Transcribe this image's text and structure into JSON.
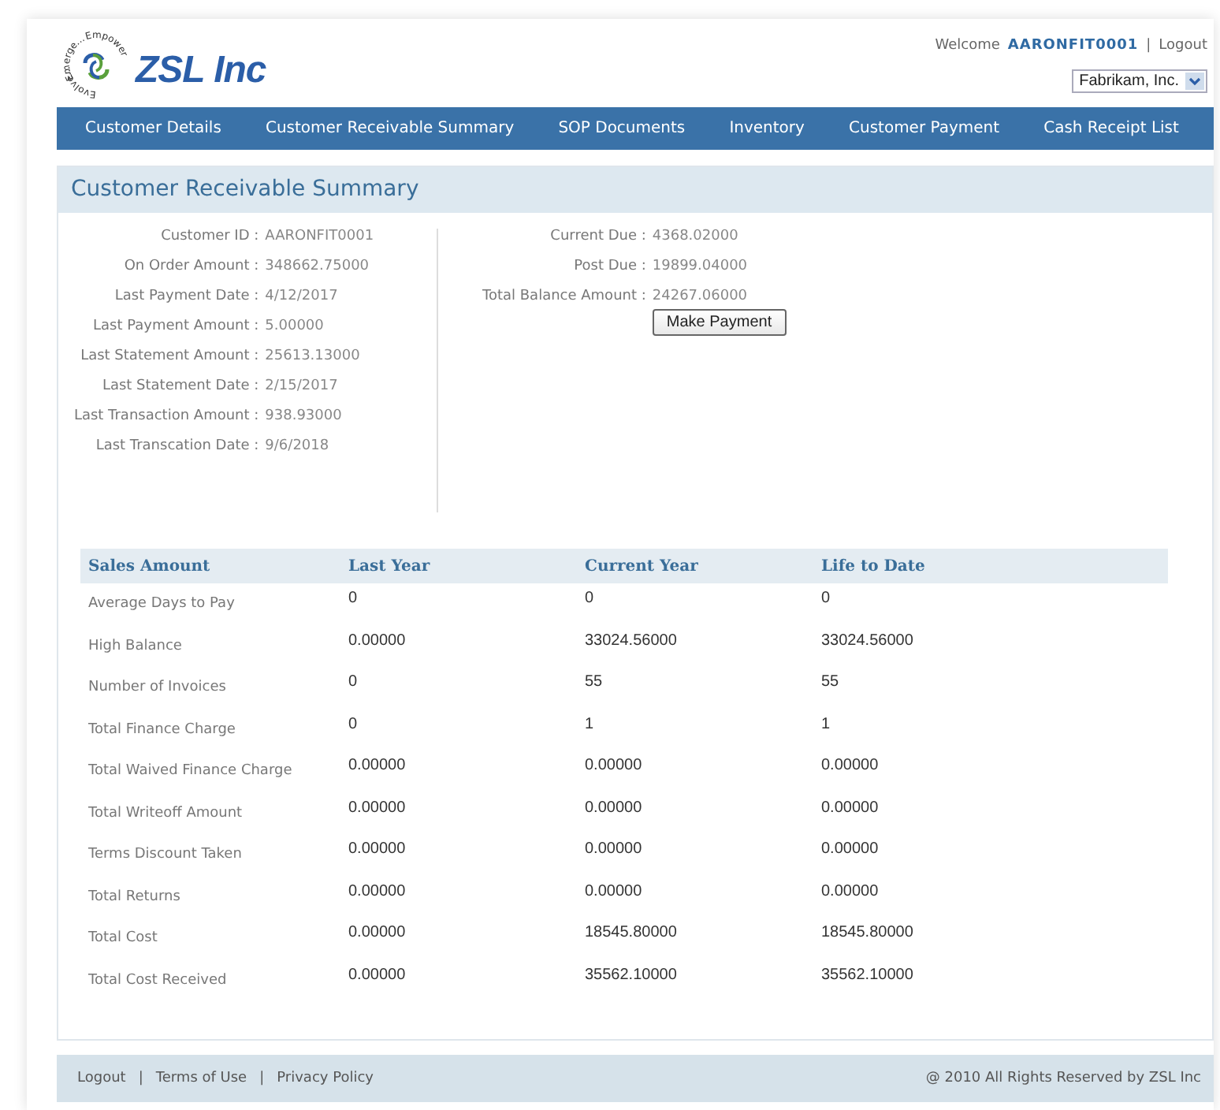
{
  "header": {
    "logo": {
      "name": "ZSL Inc",
      "ring_texts": [
        "Emerge...",
        "Empower",
        "Evolve..."
      ]
    },
    "welcome": "Welcome",
    "user": "AARONFIT0001",
    "separator": "|",
    "logout": "Logout",
    "company_select": {
      "value": "Fabrikam, Inc."
    }
  },
  "nav": [
    "Customer Details",
    "Customer Receivable Summary",
    "SOP Documents",
    "Inventory",
    "Customer Payment",
    "Cash Receipt List"
  ],
  "panel": {
    "title": "Customer Receivable Summary",
    "left_fields": [
      {
        "label": "Customer ID :",
        "value": "AARONFIT0001"
      },
      {
        "label": "On Order Amount :",
        "value": "348662.75000"
      },
      {
        "label": "Last Payment Date :",
        "value": "4/12/2017"
      },
      {
        "label": "Last Payment Amount :",
        "value": "5.00000"
      },
      {
        "label": "Last Statement Amount :",
        "value": "25613.13000"
      },
      {
        "label": "Last Statement Date :",
        "value": "2/15/2017"
      },
      {
        "label": "Last Transaction Amount :",
        "value": "938.93000"
      },
      {
        "label": "Last Transcation Date :",
        "value": "9/6/2018"
      }
    ],
    "right_fields": [
      {
        "label": "Current Due :",
        "value": "4368.02000"
      },
      {
        "label": "Post Due :",
        "value": "19899.04000"
      },
      {
        "label": "Total Balance Amount :",
        "value": "24267.06000"
      }
    ],
    "make_payment": "Make Payment",
    "table": {
      "columns": [
        "Sales Amount",
        "Last Year",
        "Current Year",
        "Life to Date"
      ],
      "rows": [
        [
          "Average Days to Pay",
          "0",
          "0",
          "0"
        ],
        [
          "High Balance",
          "0.00000",
          "33024.56000",
          "33024.56000"
        ],
        [
          "Number of Invoices",
          "0",
          "55",
          "55"
        ],
        [
          "Total Finance Charge",
          "0",
          "1",
          "1"
        ],
        [
          "Total Waived Finance Charge",
          "0.00000",
          "0.00000",
          "0.00000"
        ],
        [
          "Total Writeoff Amount",
          "0.00000",
          "0.00000",
          "0.00000"
        ],
        [
          "Terms Discount Taken",
          "0.00000",
          "0.00000",
          "0.00000"
        ],
        [
          "Total Returns",
          "0.00000",
          "0.00000",
          "0.00000"
        ],
        [
          "Total Cost",
          "0.00000",
          "18545.80000",
          "18545.80000"
        ],
        [
          "Total Cost Received",
          "0.00000",
          "35562.10000",
          "35562.10000"
        ]
      ]
    }
  },
  "footer": {
    "links": [
      "Logout",
      "Terms of Use",
      "Privacy Policy"
    ],
    "separators": [
      "|",
      "|"
    ],
    "copyright": "@ 2010 All Rights Reserved by ZSL Inc"
  }
}
